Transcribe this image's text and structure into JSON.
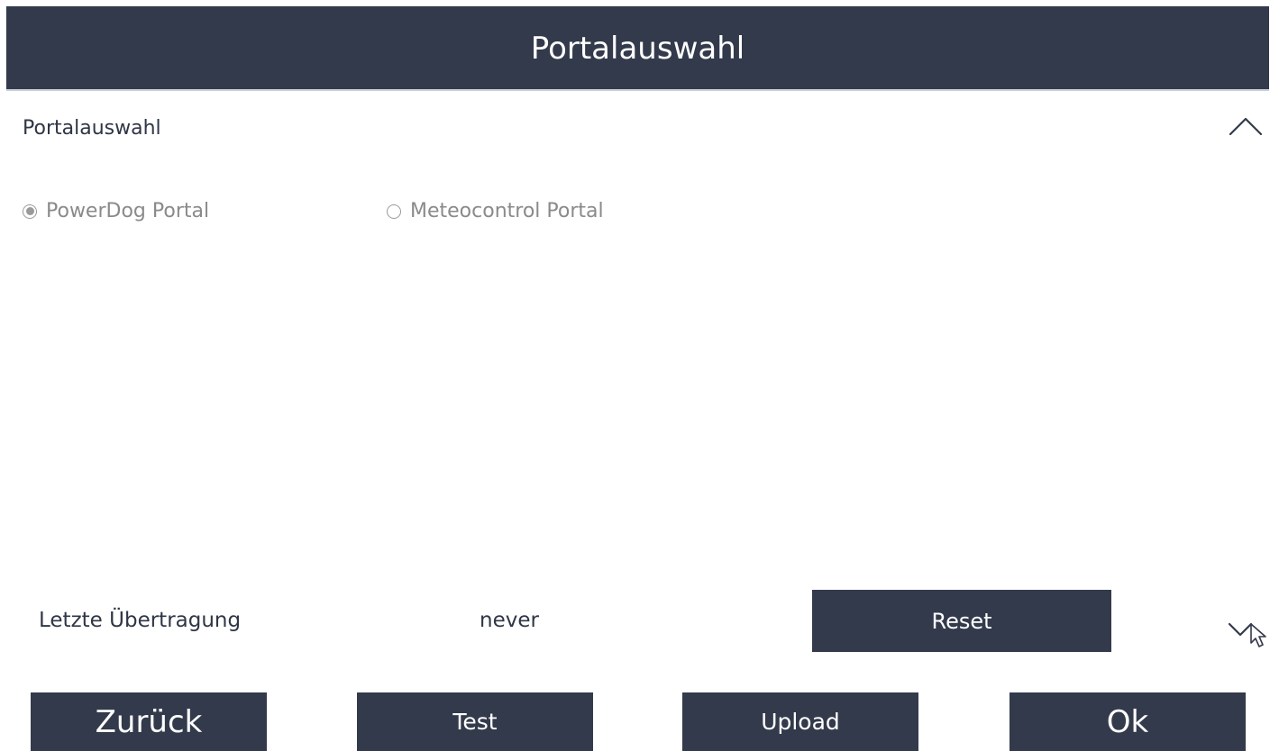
{
  "window": {
    "title": "Portalauswahl"
  },
  "section": {
    "title": "Portalauswahl",
    "collapse_icon": "chevron-up-icon"
  },
  "portal_options": [
    {
      "label": "PowerDog Portal",
      "selected": true
    },
    {
      "label": "Meteocontrol Portal",
      "selected": false
    }
  ],
  "status": {
    "label": "Letzte Übertragung",
    "value": "never",
    "reset_label": "Reset",
    "expand_icon": "chevron-down-icon"
  },
  "footer": {
    "back_label": "Zurück",
    "test_label": "Test",
    "upload_label": "Upload",
    "ok_label": "Ok"
  },
  "colors": {
    "primary": "#333a4b",
    "text": "#2f3646",
    "disabled_text": "#8a8a8a"
  }
}
